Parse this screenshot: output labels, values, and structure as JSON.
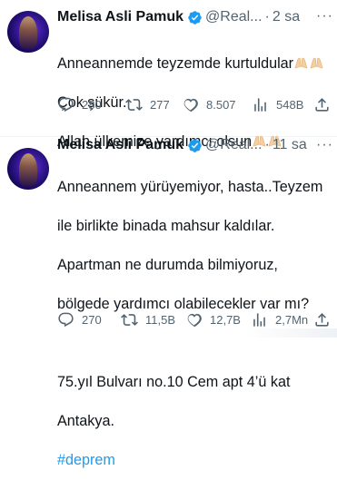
{
  "tweets": [
    {
      "author": {
        "name": "Melisa Asli Pamuk",
        "handle": "@Real...",
        "verified": true
      },
      "time": "2 sa",
      "separator": "·",
      "lines": [
        "Anneannemde teyzemde kurtuldular",
        "Çok şükür.",
        "Allah ülkemize yardımcı olsun"
      ],
      "emoji": "praying-hands",
      "stats": {
        "replies": "280",
        "retweets": "277",
        "likes": "8.507",
        "views": "548B"
      }
    },
    {
      "author": {
        "name": "Melisa Asli Pamuk",
        "handle": "@Real...",
        "verified": true
      },
      "time": "11 sa",
      "separator": "·",
      "lines": [
        "Anneannem yürüyemiyor, hasta..Teyzem",
        "ile birlikte binada mahsur kaldılar.",
        "Apartman ne durumda bilmiyoruz,",
        "bölgede yardımcı olabilecekler var mı?",
        "",
        "75.yıl Bulvarı no.10 Cem apt 4’ü kat",
        "Antakya."
      ],
      "hashtag": "#deprem",
      "stats": {
        "replies": "270",
        "retweets": "11,5B",
        "likes": "12,7B",
        "views": "2,7Mn"
      }
    }
  ],
  "more_label": "···",
  "colors": {
    "accent": "#1d9bf0",
    "muted": "#536471",
    "text": "#0f1419"
  }
}
